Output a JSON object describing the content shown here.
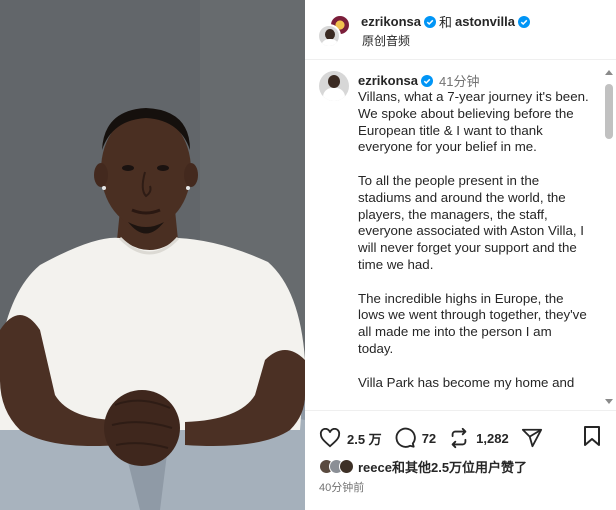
{
  "video": {
    "description_icon": "video-frame"
  },
  "header": {
    "user1": "ezrikonsa",
    "and": "和",
    "user2": "astonvilla",
    "subtitle": "原创音频"
  },
  "caption": {
    "username": "ezrikonsa",
    "time": "41分钟",
    "paragraphs": [
      "Villans, what a 7-year journey it's been. We spoke about believing before the European title & I want to thank everyone for your belief in me.",
      "To all the people present in the stadiums and around the world, the players, the managers, the staff, everyone associated with Aston Villa, I will never forget your support and the time we had.",
      "The incredible highs in Europe, the lows we went through together, they've all made me into the person I am today.",
      "Villa Park has become my home and"
    ]
  },
  "actions": {
    "likes": "2.5 万",
    "comments": "72",
    "reposts": "1,282",
    "liked_by": "reece和其他2.5万位用户赞了",
    "timestamp": "40分钟前"
  },
  "colors": {
    "verified": "#0095f6",
    "text": "#262626",
    "muted": "#737373"
  }
}
